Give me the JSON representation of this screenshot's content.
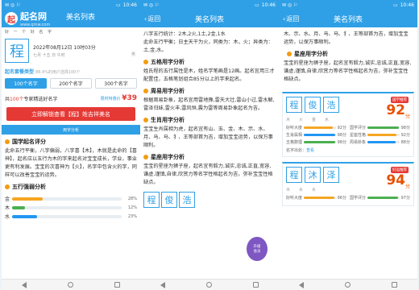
{
  "status": {
    "left_icons": "✉ ◎ ⚐",
    "time": "10:46",
    "battery": "▭"
  },
  "panel1": {
    "logo_char": "起",
    "logo_text": "起名网",
    "logo_sub": "www.qmw.com",
    "title": "美名列表",
    "slogan": "好 一 个 好 名 字",
    "surname": "程",
    "date": "2022年08月12日 10时03分",
    "lunar": "七月 十五 日 午时",
    "gender": "男",
    "settings_label": "起名套餐类型",
    "settings_hint": "88.4%的用户选择100个",
    "count_options": [
      "100个名字",
      "200个名字",
      "300个名字"
    ],
    "count_active": 0,
    "info_prefix": "共",
    "info_count": "100个",
    "info_suffix": "专家精选好名字",
    "price_label": "限时特惠价",
    "price": "¥39",
    "unlock_btn": "立即解锁查看【程】姓吉祥美名",
    "tab_label": "用字分析",
    "section1_title": "国学起名评分",
    "section1_text": "此命五行平衡，八字偏弱，八字喜【木】，木就是此命的【喜神】，起名应以五行为木的字来起名对宝宝成长，学业，事业更有利发展。宝宝的次喜神为【火】，名字中包含火的字，同样可以改善宝宝的运势。",
    "section2_title": "五行强弱分析",
    "elements": [
      {
        "name": "金",
        "color": "#f5a623",
        "value": 0.28,
        "label": "28%"
      },
      {
        "name": "木",
        "color": "#4caf50",
        "value": 0.12,
        "label": "12%"
      },
      {
        "name": "水",
        "color": "#2196f3",
        "value": 0.23,
        "label": "23%"
      }
    ]
  },
  "panel2": {
    "back": "返回",
    "title": "美名列表",
    "p1": "八字五行统计：2木,2火,1土,2金,1水",
    "p2": "此命五行平衡；日主天干为火，同类为：木，火；异类为：土,金,水。",
    "s1_title": "五格用字分析",
    "s1_text": "姓氏程的五行属性是木，姓名学笔画是12画。起名宜用三才配置佳，五格笔划组合85分以上的字来起名。",
    "s2_title": "周易用字分析",
    "s2_text": "根据周易卦象，起名宜用雷地豫,雷天大壮,雷山小过,雷水解,雷泽归妹,雷火丰,雷风恒,震为雷等周易卦象起名为吉。",
    "s3_title": "生肖用字分析",
    "s3_text": "宝宝生肖属相为虎，起名宜有山、玉、金、木、示、水、月、马、马、犭、王等部首为吉，增加宝宝运势，以保万事顺利。",
    "s4_title": "星座用字分析",
    "s4_text": "宝宝的星座为狮子座，起名宜有毅力,诚实,忠诚,正直,宽容,谦虚,谨慎,自律,欣赏力等名字性格起名为吉，弥补宝宝性格缺点。",
    "badge_line1": "升级",
    "badge_line2": "会员",
    "card_chars": [
      "程",
      "俊",
      "浩"
    ]
  },
  "panel3": {
    "back": "返回",
    "title": "美名列表",
    "top_text": "木、示、水、月、马、马、犭、王等部首为吉，增加宝宝运势，以保万事顺利。",
    "s_title": "星座用字分析",
    "s_text": "宝宝的星座为狮子座，起名宜有毅力,诚实,忠诚,正直,宽容,谦虚,谨慎,自律,欣赏力等名字性格起名为吉，弥补宝宝性格缺点。",
    "cards": [
      {
        "chars": [
          "程",
          "俊",
          "浩"
        ],
        "tag": "国学推荐",
        "score": "92",
        "unit": "分",
        "icons": [
          "木",
          "火",
          "金",
          "水"
        ],
        "metrics": [
          {
            "name": "好听大度",
            "value": 0.92,
            "label": "92分",
            "color": "#f5a623"
          },
          {
            "name": "国学评分",
            "value": 0.98,
            "label": "98分",
            "color": "#4caf50"
          },
          {
            "name": "生肖属相",
            "value": 0.98,
            "label": "98分",
            "color": "#2196f3"
          },
          {
            "name": "星座性格",
            "value": 0.92,
            "label": "92分",
            "color": "#f5a623"
          },
          {
            "name": "五格数理",
            "value": 0.98,
            "label": "98分",
            "color": "#4caf50"
          },
          {
            "name": "周易卦象",
            "value": 0.88,
            "label": "88分",
            "color": "#2196f3"
          }
        ],
        "origin_label": "名字出处：",
        "origin_link": "查看"
      },
      {
        "chars": [
          "程",
          "沐",
          "泽"
        ],
        "tag": "好运推荐",
        "score": "94",
        "unit": "分",
        "icons": [
          "木",
          "水",
          "水"
        ],
        "metrics": [
          {
            "name": "好听大度",
            "value": 0.96,
            "label": "96分",
            "color": "#f5a623"
          },
          {
            "name": "国学评分",
            "value": 0.97,
            "label": "97分",
            "color": "#4caf50"
          }
        ]
      }
    ]
  }
}
